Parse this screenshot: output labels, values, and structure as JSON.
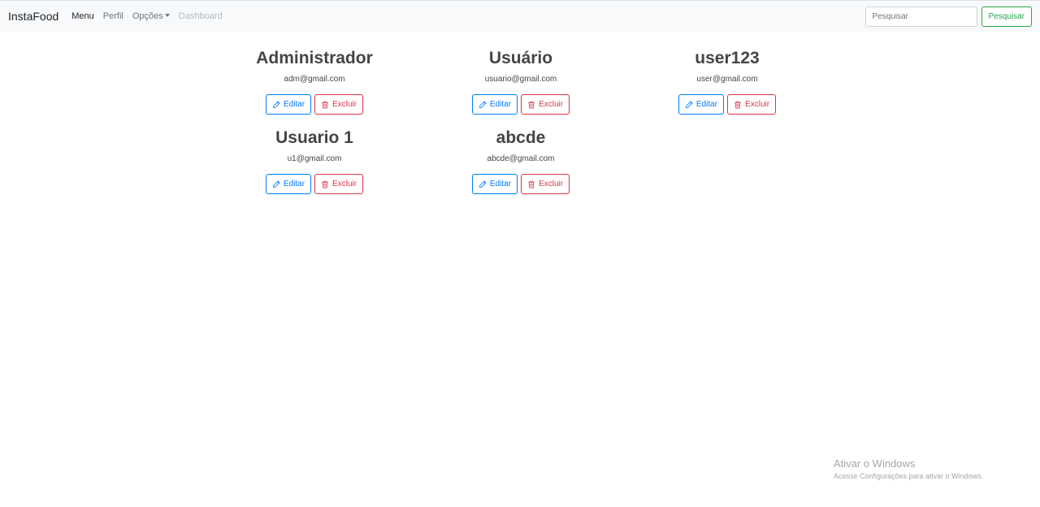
{
  "navbar": {
    "brand": "InstaFood",
    "links": {
      "menu": "Menu",
      "perfil": "Perfil",
      "opcoes": "Opções",
      "dashboard": "Dashboard"
    },
    "search": {
      "placeholder": "Pesquisar",
      "value": "",
      "button_label": "Pesquisar"
    }
  },
  "users": [
    {
      "name": "Administrador",
      "email": "adm@gmail.com",
      "edit_label": "Editar",
      "delete_label": "Excluir"
    },
    {
      "name": "Usuário",
      "email": "usuario@gmail.com",
      "edit_label": "Editar",
      "delete_label": "Excluir"
    },
    {
      "name": "user123",
      "email": "user@gmail.com",
      "edit_label": "Editar",
      "delete_label": "Excluir"
    },
    {
      "name": "Usuario 1",
      "email": "u1@gmail.com",
      "edit_label": "Editar",
      "delete_label": "Excluir"
    },
    {
      "name": "abcde",
      "email": "abcde@gmail.com",
      "edit_label": "Editar",
      "delete_label": "Excluir"
    }
  ],
  "icons": {
    "edit": "pencil-icon",
    "delete": "trash-icon",
    "dropdown": "caret-down-icon"
  },
  "colors": {
    "primary": "#007bff",
    "danger": "#dc3545",
    "success": "#28a745",
    "navbar_bg": "#f8f9fa"
  },
  "watermark": {
    "title": "Ativar o Windows",
    "subtitle": "Acesse Configurações para ativar o Windows."
  }
}
